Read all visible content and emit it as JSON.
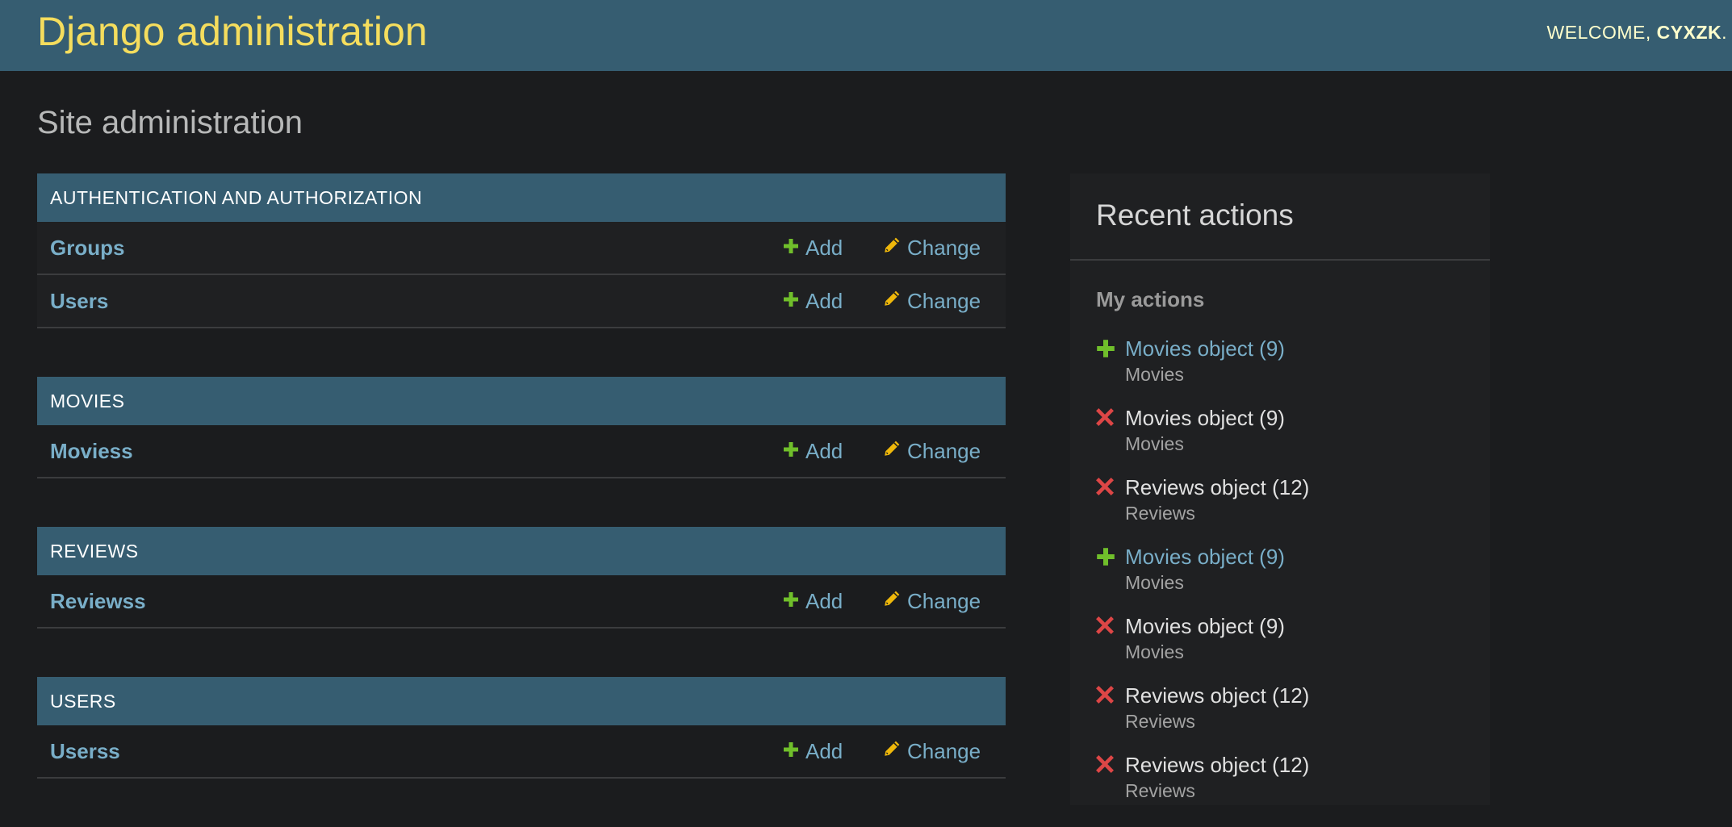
{
  "header": {
    "brand": "Django administration",
    "welcome": "WELCOME,",
    "username": "CYXZK",
    "trailing": "."
  },
  "page_title": "Site administration",
  "apps": [
    {
      "caption": "Authentication and Authorization",
      "models": [
        {
          "name": "Groups",
          "add": "Add",
          "change": "Change"
        },
        {
          "name": "Users",
          "add": "Add",
          "change": "Change"
        }
      ]
    },
    {
      "caption": "Movies",
      "models": [
        {
          "name": "Moviess",
          "add": "Add",
          "change": "Change"
        }
      ]
    },
    {
      "caption": "Reviews",
      "models": [
        {
          "name": "Reviewss",
          "add": "Add",
          "change": "Change"
        }
      ]
    },
    {
      "caption": "Users",
      "models": [
        {
          "name": "Userss",
          "add": "Add",
          "change": "Change"
        }
      ]
    }
  ],
  "recent_actions": {
    "title": "Recent actions",
    "subtitle": "My actions",
    "items": [
      {
        "action": "add",
        "object": "Movies object (9)",
        "type": "Movies"
      },
      {
        "action": "delete",
        "object": "Movies object (9)",
        "type": "Movies"
      },
      {
        "action": "delete",
        "object": "Reviews object (12)",
        "type": "Reviews"
      },
      {
        "action": "add",
        "object": "Movies object (9)",
        "type": "Movies"
      },
      {
        "action": "delete",
        "object": "Movies object (9)",
        "type": "Movies"
      },
      {
        "action": "delete",
        "object": "Reviews object (12)",
        "type": "Reviews"
      },
      {
        "action": "delete",
        "object": "Reviews object (12)",
        "type": "Reviews"
      }
    ]
  },
  "colors": {
    "header_bg": "#365d71",
    "brand": "#f5dd5d",
    "link": "#79aec8",
    "add_icon": "#70bf2b",
    "change_icon": "#efb80b",
    "delete_icon": "#dd4646"
  },
  "icons": {
    "add": "plus-icon",
    "change": "pencil-icon",
    "delete": "x-icon"
  }
}
